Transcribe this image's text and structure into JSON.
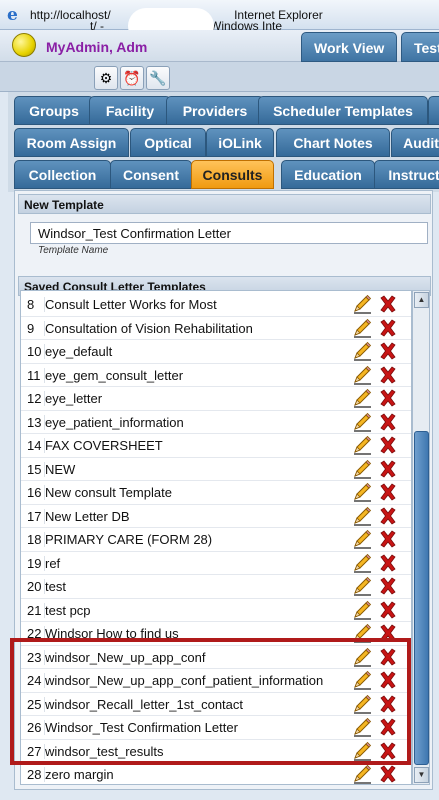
{
  "window": {
    "url": "http://localhost/",
    "title_fragment": "t/ -",
    "browser": "Windows Inte",
    "browser_top": "Internet Explorer"
  },
  "header": {
    "user": "MyAdmin, Adm",
    "tabs": [
      "Work View",
      "Test"
    ]
  },
  "tabs": {
    "row1": [
      "Groups",
      "Facility",
      "Providers",
      "Scheduler Templates"
    ],
    "row2": [
      "Room Assign",
      "Optical",
      "iOLink",
      "Chart Notes",
      "Audit"
    ],
    "row3": [
      "Collection",
      "Consent",
      "Consults",
      "Education",
      "Instruct"
    ]
  },
  "new_template": {
    "header": "New Template",
    "value": "Windsor_Test Confirmation Letter",
    "label": "Template Name"
  },
  "saved": {
    "header": "Saved Consult Letter Templates",
    "rows": [
      {
        "num": "8",
        "name": "Consult Letter Works for Most"
      },
      {
        "num": "9",
        "name": "Consultation of Vision Rehabilitation"
      },
      {
        "num": "10",
        "name": "eye_default"
      },
      {
        "num": "11",
        "name": "eye_gem_consult_letter"
      },
      {
        "num": "12",
        "name": "eye_letter"
      },
      {
        "num": "13",
        "name": "eye_patient_information"
      },
      {
        "num": "14",
        "name": "FAX COVERSHEET"
      },
      {
        "num": "15",
        "name": "NEW"
      },
      {
        "num": "16",
        "name": "New consult Template"
      },
      {
        "num": "17",
        "name": "New Letter DB"
      },
      {
        "num": "18",
        "name": "PRIMARY CARE (FORM 28)"
      },
      {
        "num": "19",
        "name": "ref"
      },
      {
        "num": "20",
        "name": "test"
      },
      {
        "num": "21",
        "name": "test pcp"
      },
      {
        "num": "22",
        "name": "Windsor How to find us"
      },
      {
        "num": "23",
        "name": "windsor_New_up_app_conf"
      },
      {
        "num": "24",
        "name": "windsor_New_up_app_conf_patient_information"
      },
      {
        "num": "25",
        "name": "windsor_Recall_letter_1st_contact"
      },
      {
        "num": "26",
        "name": "Windsor_Test Confirmation Letter"
      },
      {
        "num": "27",
        "name": "windsor_test_results"
      },
      {
        "num": "28",
        "name": "zero margin"
      }
    ]
  },
  "colors": {
    "accent_tab": "#f09a10",
    "tab_blue": "#356a99",
    "highlight": "#b01a1a",
    "user_name": "#8a1fa5",
    "delete_red": "#c81414"
  }
}
